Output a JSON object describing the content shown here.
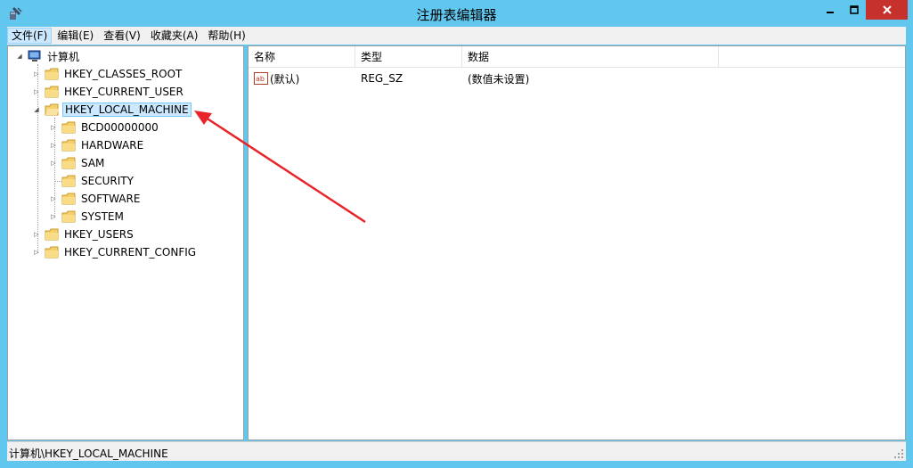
{
  "window": {
    "title": "注册表编辑器",
    "buttons": {
      "minimize": "minimize",
      "maximize": "maximize",
      "close": "close"
    }
  },
  "menu": [
    "文件(F)",
    "编辑(E)",
    "查看(V)",
    "收藏夹(A)",
    "帮助(H)"
  ],
  "tree": {
    "root": "计算机",
    "hives": [
      {
        "label": "HKEY_CLASSES_ROOT"
      },
      {
        "label": "HKEY_CURRENT_USER"
      },
      {
        "label": "HKEY_LOCAL_MACHINE",
        "selected": true
      },
      {
        "label": "HKEY_USERS"
      },
      {
        "label": "HKEY_CURRENT_CONFIG"
      }
    ],
    "hklm_children": [
      {
        "label": "BCD00000000"
      },
      {
        "label": "HARDWARE"
      },
      {
        "label": "SAM"
      },
      {
        "label": "SECURITY"
      },
      {
        "label": "SOFTWARE"
      },
      {
        "label": "SYSTEM"
      }
    ]
  },
  "list": {
    "columns": [
      "名称",
      "类型",
      "数据"
    ],
    "rows": [
      {
        "name": "(默认)",
        "type": "REG_SZ",
        "data": "(数值未设置)",
        "icon": "string-value-icon"
      }
    ]
  },
  "status": {
    "path": "计算机\\HKEY_LOCAL_MACHINE"
  },
  "colors": {
    "frame": "#62c7ee",
    "close": "#c7312b",
    "selection": "#cce8ff",
    "arrow": "#e8232a"
  }
}
